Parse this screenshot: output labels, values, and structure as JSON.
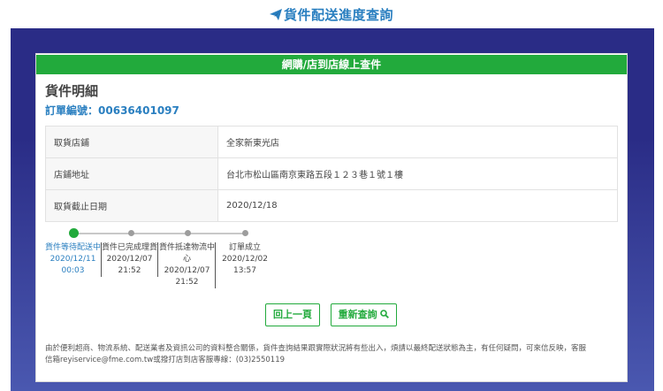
{
  "header": {
    "title": "貨件配送進度查詢",
    "icon": "paper-plane-icon"
  },
  "panel": {
    "bar_title": "網購/店到店線上查件"
  },
  "details": {
    "heading": "貨件明細",
    "order_label": "訂單編號：",
    "order_number": "00636401097",
    "rows": [
      {
        "label": "取貨店鋪",
        "value": "全家新東光店"
      },
      {
        "label": "店鋪地址",
        "value": "台北市松山區南京東路五段１２３巷１號１樓"
      },
      {
        "label": "取貨截止日期",
        "value": "2020/12/18"
      }
    ]
  },
  "progress": {
    "steps": [
      {
        "name": "貨件等待配送中",
        "date": "2020/12/11",
        "time": "00:03",
        "active": true
      },
      {
        "name": "貨件已完成理貨",
        "date": "2020/12/07",
        "time": "21:52",
        "active": false
      },
      {
        "name": "貨件抵達物流中心",
        "date": "2020/12/07",
        "time": "21:52",
        "active": false
      },
      {
        "name": "訂單成立",
        "date": "2020/12/02",
        "time": "13:57",
        "active": false
      }
    ]
  },
  "buttons": {
    "back": "回上一頁",
    "requery": "重新查詢"
  },
  "footer": {
    "line1": "由於便利超商、物流系統、配送業者及資訊公司的資料整合關係，貨件查詢結果跟實際狀況將有些出入，煩請以最終配送狀態為主，有任何疑問，可來信反映，客服",
    "line2": "信箱reyiservice@fme.com.tw或撥打店到店客服專線：(03)2550119"
  },
  "colors": {
    "accent": "#2a7fc0",
    "green": "#22aa3c",
    "navy": "#2a2c86"
  }
}
